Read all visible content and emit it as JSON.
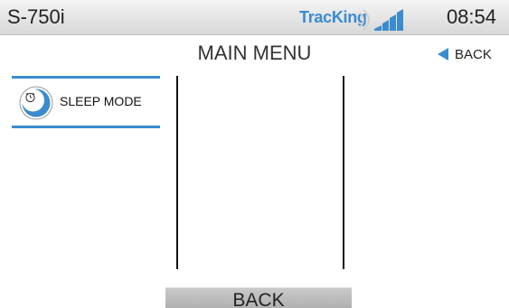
{
  "status_bar": {
    "device_name": "S-750i",
    "brand": "TracKing",
    "time": "08:54",
    "icons": [
      "signal-waves-icon",
      "signal-bars-icon"
    ]
  },
  "header": {
    "title": "MAIN MENU",
    "back_label": "BACK",
    "back_icon": "left-triangle-icon"
  },
  "menu": {
    "items": [
      {
        "label": "SLEEP MODE",
        "icon": "sleep-alarm-icon"
      }
    ]
  },
  "footer": {
    "back_button_label": "BACK"
  },
  "colors": {
    "accent": "#3b8ccf",
    "status_bar_bg": "#e6e6e6",
    "footer_button_bg": "#b8b8b8",
    "divider": "#111111"
  }
}
